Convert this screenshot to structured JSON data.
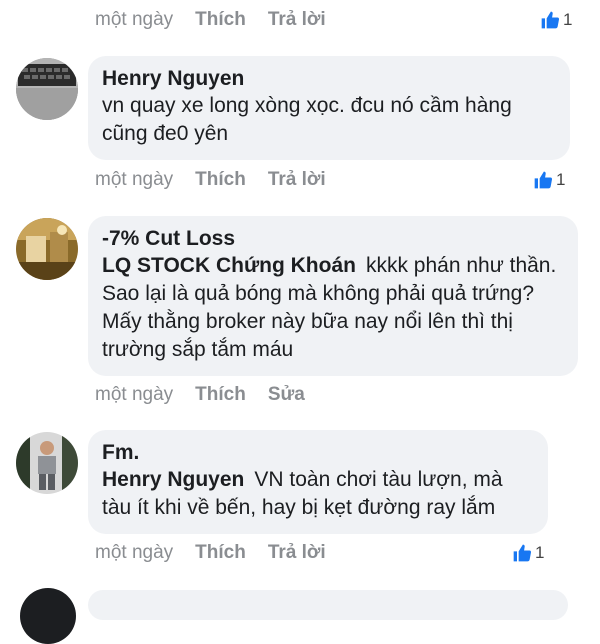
{
  "top_meta": {
    "time": "một ngày",
    "like": "Thích",
    "reply": "Trả lời",
    "likes": "1"
  },
  "comments": [
    {
      "author": "Henry Nguyen",
      "mention": "",
      "text": "vn quay xe long xòng xọc. đcu nó cầm hàng cũng đe0 yên",
      "time": "một ngày",
      "like": "Thích",
      "action": "Trả lời",
      "likes": "1"
    },
    {
      "author": "-7% Cut Loss",
      "mention": "LQ STOCK Chứng Khoán",
      "text": "kkkk phán như thần. Sao lại là quả bóng mà không phải quả trứng? Mấy thằng broker này bữa nay nổi lên thì thị trường sắp tắm máu",
      "time": "một ngày",
      "like": "Thích",
      "action": "Sửa",
      "likes": ""
    },
    {
      "author": "Fm.",
      "mention": "Henry Nguyen",
      "text": "VN toàn chơi tàu lượn, mà tàu ít khi về bến, hay bị kẹt đường ray lắm",
      "time": "một ngày",
      "like": "Thích",
      "action": "Trả lời",
      "likes": "1"
    }
  ],
  "colors": {
    "bubble": "#f0f2f5",
    "meta": "#8a8d91",
    "like_blue": "#1877f2"
  }
}
